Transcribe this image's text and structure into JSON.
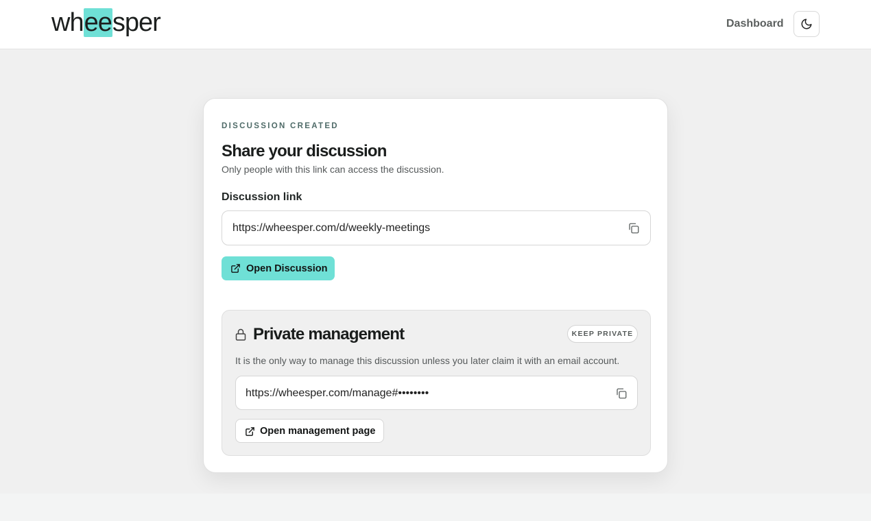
{
  "header": {
    "logo_pre": "wh",
    "logo_highlight": "ee",
    "logo_post": "sper",
    "nav_dashboard": "Dashboard",
    "theme_toggle_icon": "moon-icon"
  },
  "card": {
    "eyebrow": "DISCUSSION CREATED",
    "title": "Share your discussion",
    "subtitle": "Only people with this link can access the discussion.",
    "link_label": "Discussion link",
    "link_value": "https://wheesper.com/d/weekly-meetings",
    "open_button": "Open Discussion"
  },
  "private": {
    "title": "Private management",
    "badge": "KEEP PRIVATE",
    "description": "It is the only way to manage this discussion unless you later claim it with an email account.",
    "manage_value": "https://wheesper.com/manage#••••••••",
    "open_button": "Open management page"
  },
  "colors": {
    "accent": "#6fe0d6",
    "page_bg": "#f0f0f0",
    "card_bg": "#ffffff"
  }
}
